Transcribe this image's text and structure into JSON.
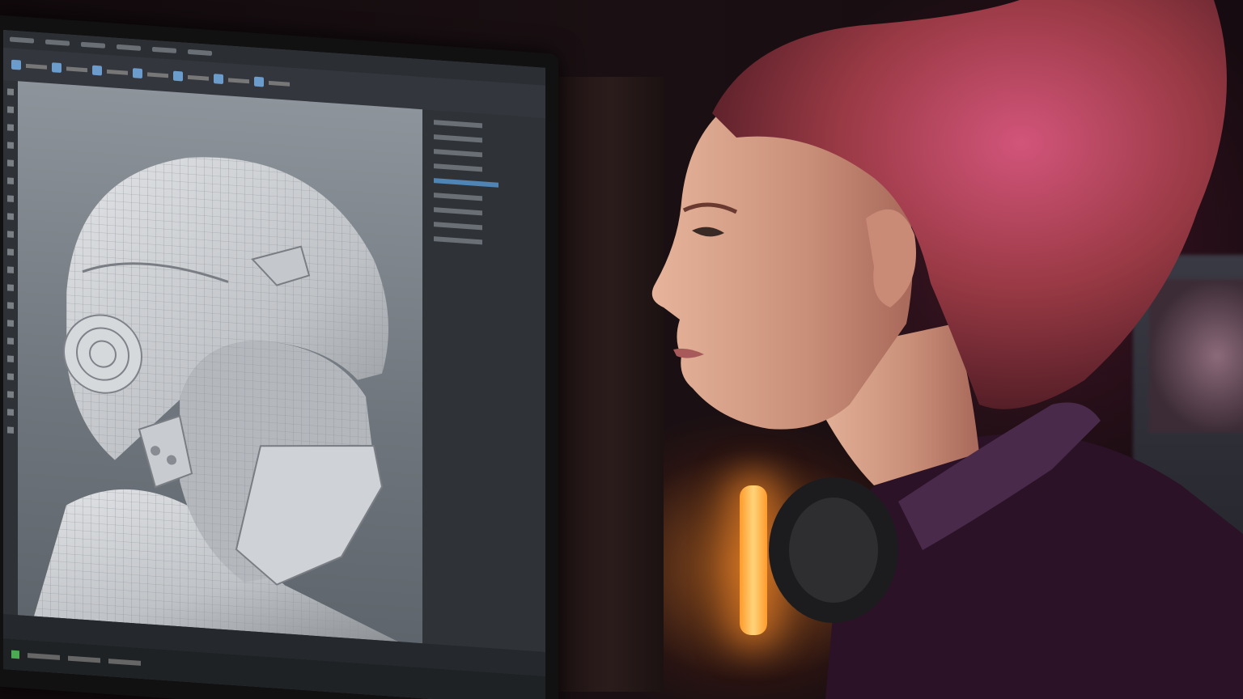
{
  "scene": {
    "description_tags": [
      "monitor-3d-modeling-software",
      "helmet-wireframe-model",
      "person-profile",
      "headphones"
    ],
    "colors": {
      "ambient_pink": "#c8466e",
      "lamp_orange": "#ff9b2b",
      "shirt_purple": "#2b1226",
      "skin": "#d9a48c",
      "hair": "#8a3b3e",
      "model_gray": "#c9ccd0",
      "ui_accent": "#4f84b5"
    }
  },
  "software_ui": {
    "menu_items": 6,
    "toolbar_icons": 14,
    "outliner_rows": 9,
    "selected_row": 5
  }
}
